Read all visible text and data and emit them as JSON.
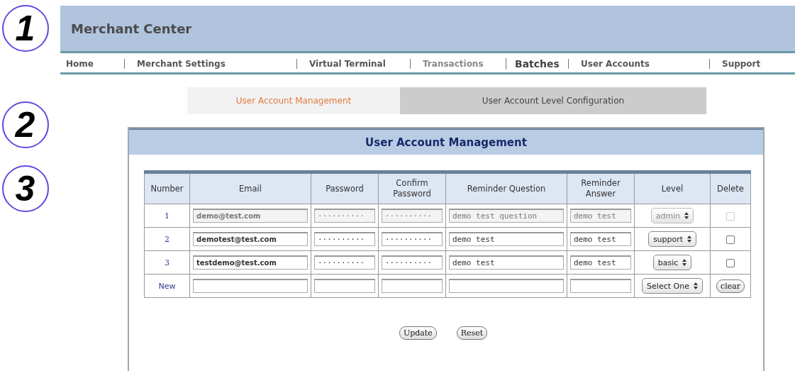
{
  "annotations": [
    "1",
    "2",
    "3"
  ],
  "header": {
    "title": "Merchant Center"
  },
  "nav": [
    "Home",
    "Merchant Settings",
    "Virtual Terminal",
    "Transactions",
    "Batches",
    "User Accounts",
    "Support"
  ],
  "subtabs": [
    {
      "label": "User Account Management",
      "selected": true
    },
    {
      "label": "User Account Level Configuration",
      "selected": false
    }
  ],
  "panel": {
    "title": "User Account Management"
  },
  "table": {
    "columns": [
      "Number",
      "Email",
      "Password",
      "Confirm Password",
      "Reminder Question",
      "Reminder Answer",
      "Level",
      "Delete"
    ],
    "rows": [
      {
        "number": "1",
        "email": "demo@test.com",
        "password": "··········",
        "confirm": "··········",
        "question": "demo test question",
        "answer": "demo test",
        "level": "admin",
        "disabled": true,
        "checked": false
      },
      {
        "number": "2",
        "email": "demotest@test.com",
        "password": "··········",
        "confirm": "··········",
        "question": "demo test",
        "answer": "demo test",
        "level": "support",
        "disabled": false,
        "checked": false
      },
      {
        "number": "3",
        "email": "testdemo@test.com",
        "password": "··········",
        "confirm": "··········",
        "question": "demo test",
        "answer": "demo test",
        "level": "basic",
        "disabled": false,
        "checked": false
      }
    ],
    "new_row": {
      "number": "New",
      "level_placeholder": "Select One",
      "clear": "clear"
    }
  },
  "buttons": [
    "Update",
    "Reset"
  ]
}
